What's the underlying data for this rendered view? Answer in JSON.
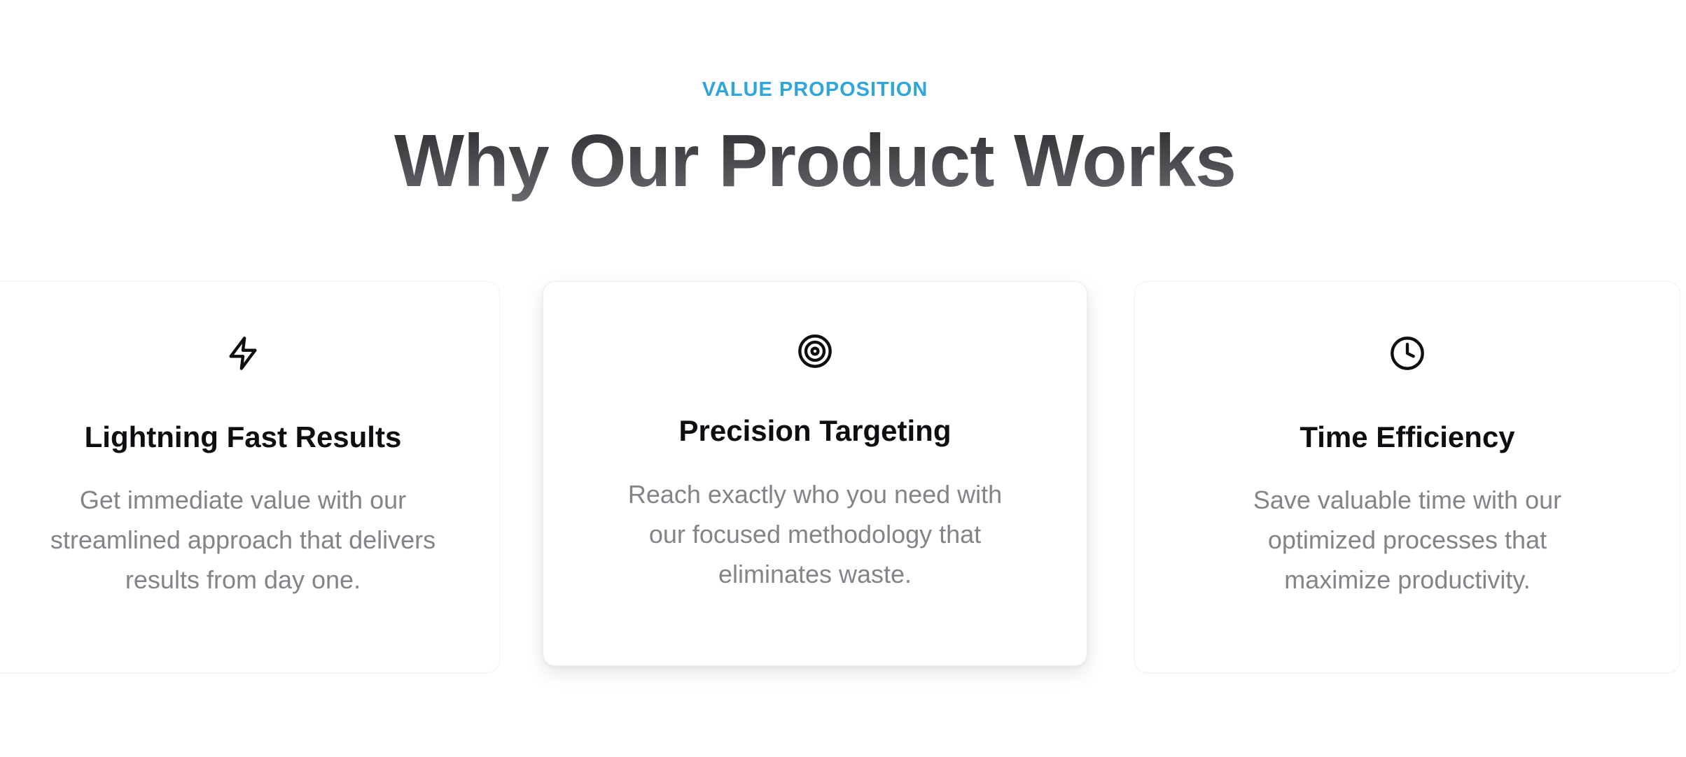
{
  "section": {
    "eyebrow": "VALUE PROPOSITION",
    "title": "Why Our Product Works"
  },
  "colors": {
    "accent": "#2ea6dc",
    "title_gradient_top": "#2a2a2e",
    "title_gradient_bottom": "#6a6a70",
    "card_title": "#0d0d12",
    "card_text": "#838389"
  },
  "cards": [
    {
      "icon": "lightning-bolt-icon",
      "title": "Lightning Fast Results",
      "text": "Get immediate value with our streamlined approach that delivers results from day one."
    },
    {
      "icon": "target-icon",
      "title": "Precision Targeting",
      "text": "Reach exactly who you need with our focused methodology that eliminates waste."
    },
    {
      "icon": "clock-icon",
      "title": "Time Efficiency",
      "text": "Save valuable time with our optimized processes that maximize productivity."
    }
  ]
}
